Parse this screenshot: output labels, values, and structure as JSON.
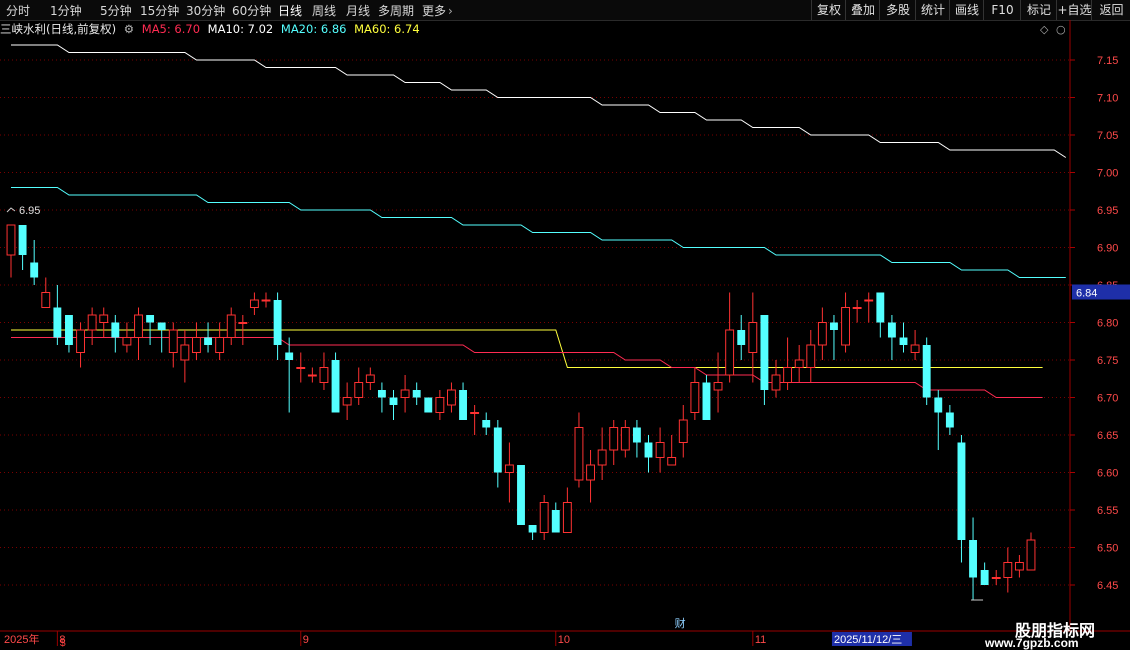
{
  "toolbar": {
    "periods": [
      "分时",
      "1分钟",
      "5分钟",
      "15分钟",
      "30分钟",
      "60分钟",
      "日线",
      "周线",
      "月线",
      "多周期",
      "更多"
    ],
    "active_period": "日线",
    "right_buttons": [
      "复权",
      "叠加",
      "多股",
      "统计",
      "画线",
      "F10",
      "标记",
      "+自选",
      "返回"
    ]
  },
  "info": {
    "stock_title": "三峡水利(日线,前复权)",
    "ma5_label": "MA5: 6.70",
    "ma10_label": "MA10: 7.02",
    "ma20_label": "MA20: 6.86",
    "ma60_label": "MA60: 6.74"
  },
  "colors": {
    "up": "#ff3232",
    "down": "#54ffff",
    "ma5": "#ff2b52",
    "ma10": "#ffffff",
    "ma20": "#54ffff",
    "ma60": "#ffff3c",
    "grid": "#7a0000",
    "axis_text": "#ff4a4a",
    "price_box": "#1e2fa8"
  },
  "chart_data": {
    "type": "candlestick",
    "yticks": [
      7.15,
      7.1,
      7.05,
      7.0,
      6.95,
      6.9,
      6.85,
      6.8,
      6.75,
      6.7,
      6.65,
      6.6,
      6.55,
      6.5,
      6.45
    ],
    "ylim": [
      6.42,
      7.18
    ],
    "current_price_label": "6.84",
    "high_marker": "6.95",
    "x_labels": [
      {
        "text": "2025年",
        "index": 0
      },
      {
        "text": "8",
        "index": 4
      },
      {
        "text": "9",
        "index": 25
      },
      {
        "text": "10",
        "index": 47
      },
      {
        "text": "11",
        "index": 64
      },
      {
        "text": "2025/11/12/三",
        "index": 71
      }
    ],
    "finance_marker": "财",
    "candles": [
      [
        6.89,
        6.93,
        6.93,
        6.86
      ],
      [
        6.93,
        6.89,
        6.93,
        6.87
      ],
      [
        6.88,
        6.86,
        6.91,
        6.85
      ],
      [
        6.82,
        6.84,
        6.86,
        6.83
      ],
      [
        6.82,
        6.78,
        6.85,
        6.77
      ],
      [
        6.81,
        6.77,
        6.81,
        6.76
      ],
      [
        6.76,
        6.79,
        6.8,
        6.74
      ],
      [
        6.79,
        6.81,
        6.82,
        6.77
      ],
      [
        6.8,
        6.81,
        6.82,
        6.78
      ],
      [
        6.8,
        6.78,
        6.81,
        6.76
      ],
      [
        6.77,
        6.78,
        6.8,
        6.76
      ],
      [
        6.78,
        6.81,
        6.82,
        6.75
      ],
      [
        6.81,
        6.8,
        6.81,
        6.77
      ],
      [
        6.8,
        6.79,
        6.8,
        6.76
      ],
      [
        6.76,
        6.79,
        6.8,
        6.74
      ],
      [
        6.75,
        6.77,
        6.79,
        6.72
      ],
      [
        6.76,
        6.78,
        6.8,
        6.75
      ],
      [
        6.78,
        6.77,
        6.8,
        6.76
      ],
      [
        6.76,
        6.78,
        6.8,
        6.75
      ],
      [
        6.78,
        6.81,
        6.82,
        6.77
      ],
      [
        6.8,
        6.8,
        6.81,
        6.77
      ],
      [
        6.82,
        6.83,
        6.84,
        6.81
      ],
      [
        6.83,
        6.83,
        6.84,
        6.82
      ],
      [
        6.83,
        6.77,
        6.84,
        6.75
      ],
      [
        6.76,
        6.75,
        6.78,
        6.68
      ],
      [
        6.74,
        6.74,
        6.76,
        6.72
      ],
      [
        6.73,
        6.73,
        6.74,
        6.72
      ],
      [
        6.72,
        6.74,
        6.76,
        6.71
      ],
      [
        6.75,
        6.68,
        6.76,
        6.68
      ],
      [
        6.69,
        6.7,
        6.72,
        6.67
      ],
      [
        6.7,
        6.72,
        6.74,
        6.69
      ],
      [
        6.72,
        6.73,
        6.74,
        6.71
      ],
      [
        6.71,
        6.7,
        6.72,
        6.68
      ],
      [
        6.7,
        6.69,
        6.71,
        6.67
      ],
      [
        6.7,
        6.71,
        6.73,
        6.68
      ],
      [
        6.71,
        6.7,
        6.72,
        6.69
      ],
      [
        6.7,
        6.68,
        6.7,
        6.68
      ],
      [
        6.68,
        6.7,
        6.71,
        6.67
      ],
      [
        6.69,
        6.71,
        6.72,
        6.68
      ],
      [
        6.71,
        6.67,
        6.72,
        6.67
      ],
      [
        6.68,
        6.68,
        6.69,
        6.65
      ],
      [
        6.67,
        6.66,
        6.68,
        6.65
      ],
      [
        6.66,
        6.6,
        6.67,
        6.58
      ],
      [
        6.6,
        6.61,
        6.64,
        6.56
      ],
      [
        6.61,
        6.53,
        6.61,
        6.53
      ],
      [
        6.53,
        6.52,
        6.53,
        6.51
      ],
      [
        6.52,
        6.56,
        6.57,
        6.51
      ],
      [
        6.55,
        6.52,
        6.56,
        6.52
      ],
      [
        6.52,
        6.56,
        6.58,
        6.52
      ],
      [
        6.59,
        6.66,
        6.68,
        6.58
      ],
      [
        6.59,
        6.61,
        6.63,
        6.56
      ],
      [
        6.61,
        6.63,
        6.66,
        6.59
      ],
      [
        6.63,
        6.66,
        6.67,
        6.61
      ],
      [
        6.63,
        6.66,
        6.67,
        6.62
      ],
      [
        6.66,
        6.64,
        6.67,
        6.62
      ],
      [
        6.64,
        6.62,
        6.65,
        6.6
      ],
      [
        6.62,
        6.64,
        6.66,
        6.6
      ],
      [
        6.61,
        6.62,
        6.65,
        6.61
      ],
      [
        6.64,
        6.67,
        6.69,
        6.62
      ],
      [
        6.68,
        6.72,
        6.74,
        6.67
      ],
      [
        6.72,
        6.67,
        6.73,
        6.67
      ],
      [
        6.71,
        6.72,
        6.76,
        6.68
      ],
      [
        6.73,
        6.79,
        6.84,
        6.72
      ],
      [
        6.79,
        6.77,
        6.81,
        6.75
      ],
      [
        6.76,
        6.8,
        6.84,
        6.72
      ],
      [
        6.81,
        6.71,
        6.81,
        6.69
      ],
      [
        6.71,
        6.73,
        6.75,
        6.7
      ],
      [
        6.72,
        6.74,
        6.78,
        6.71
      ],
      [
        6.74,
        6.75,
        6.77,
        6.72
      ],
      [
        6.74,
        6.77,
        6.79,
        6.72
      ],
      [
        6.77,
        6.8,
        6.82,
        6.75
      ],
      [
        6.8,
        6.79,
        6.81,
        6.75
      ],
      [
        6.77,
        6.82,
        6.84,
        6.76
      ],
      [
        6.82,
        6.82,
        6.83,
        6.8
      ],
      [
        6.83,
        6.83,
        6.84,
        6.8
      ],
      [
        6.84,
        6.8,
        6.84,
        6.78
      ],
      [
        6.8,
        6.78,
        6.81,
        6.75
      ],
      [
        6.78,
        6.77,
        6.8,
        6.76
      ],
      [
        6.76,
        6.77,
        6.79,
        6.75
      ],
      [
        6.77,
        6.7,
        6.78,
        6.69
      ],
      [
        6.7,
        6.68,
        6.71,
        6.63
      ],
      [
        6.68,
        6.66,
        6.69,
        6.65
      ],
      [
        6.64,
        6.51,
        6.65,
        6.48
      ],
      [
        6.51,
        6.46,
        6.54,
        6.43
      ],
      [
        6.47,
        6.45,
        6.48,
        6.45
      ],
      [
        6.46,
        6.46,
        6.47,
        6.45
      ],
      [
        6.46,
        6.48,
        6.5,
        6.44
      ],
      [
        6.47,
        6.48,
        6.49,
        6.46
      ],
      [
        6.47,
        6.51,
        6.52,
        6.47
      ]
    ],
    "series": [
      {
        "name": "MA10",
        "values": [
          7.17,
          7.17,
          7.17,
          7.17,
          7.17,
          7.16,
          7.16,
          7.16,
          7.16,
          7.16,
          7.16,
          7.16,
          7.16,
          7.16,
          7.16,
          7.16,
          7.15,
          7.15,
          7.15,
          7.15,
          7.15,
          7.15,
          7.14,
          7.14,
          7.14,
          7.14,
          7.14,
          7.14,
          7.14,
          7.13,
          7.13,
          7.13,
          7.13,
          7.13,
          7.12,
          7.12,
          7.12,
          7.12,
          7.11,
          7.11,
          7.11,
          7.11,
          7.1,
          7.1,
          7.1,
          7.1,
          7.1,
          7.1,
          7.1,
          7.1,
          7.1,
          7.09,
          7.09,
          7.09,
          7.09,
          7.09,
          7.08,
          7.08,
          7.08,
          7.08,
          7.07,
          7.07,
          7.07,
          7.07,
          7.06,
          7.06,
          7.06,
          7.06,
          7.06,
          7.05,
          7.05,
          7.05,
          7.05,
          7.05,
          7.05,
          7.04,
          7.04,
          7.04,
          7.04,
          7.04,
          7.04,
          7.03,
          7.03,
          7.03,
          7.03,
          7.03,
          7.03,
          7.03,
          7.03,
          7.03,
          7.03,
          7.02
        ]
      },
      {
        "name": "MA20",
        "values": [
          6.98,
          6.98,
          6.98,
          6.98,
          6.98,
          6.97,
          6.97,
          6.97,
          6.97,
          6.97,
          6.97,
          6.97,
          6.97,
          6.97,
          6.97,
          6.97,
          6.97,
          6.96,
          6.96,
          6.96,
          6.96,
          6.96,
          6.96,
          6.96,
          6.96,
          6.95,
          6.95,
          6.95,
          6.95,
          6.95,
          6.95,
          6.95,
          6.94,
          6.94,
          6.94,
          6.94,
          6.94,
          6.94,
          6.94,
          6.93,
          6.93,
          6.93,
          6.93,
          6.93,
          6.93,
          6.92,
          6.92,
          6.92,
          6.92,
          6.92,
          6.92,
          6.91,
          6.91,
          6.91,
          6.91,
          6.91,
          6.91,
          6.91,
          6.9,
          6.9,
          6.9,
          6.9,
          6.9,
          6.9,
          6.9,
          6.9,
          6.89,
          6.89,
          6.89,
          6.89,
          6.89,
          6.89,
          6.89,
          6.89,
          6.89,
          6.89,
          6.88,
          6.88,
          6.88,
          6.88,
          6.88,
          6.88,
          6.87,
          6.87,
          6.87,
          6.87,
          6.87,
          6.86,
          6.86,
          6.86,
          6.86,
          6.86
        ]
      },
      {
        "name": "MA60",
        "values": [
          6.79,
          6.79,
          6.79,
          6.79,
          6.79,
          6.79,
          6.79,
          6.79,
          6.79,
          6.79,
          6.79,
          6.79,
          6.79,
          6.79,
          6.79,
          6.79,
          6.79,
          6.79,
          6.79,
          6.79,
          6.79,
          6.79,
          6.79,
          6.79,
          6.79,
          6.79,
          6.79,
          6.79,
          6.79,
          6.79,
          6.79,
          6.79,
          6.79,
          6.79,
          6.79,
          6.79,
          6.79,
          6.79,
          6.79,
          6.79,
          6.79,
          6.79,
          6.79,
          6.79,
          6.79,
          6.79,
          6.79,
          6.79,
          6.74,
          6.74,
          6.74,
          6.74,
          6.74,
          6.74,
          6.74,
          6.74,
          6.74,
          6.74,
          6.74,
          6.74,
          6.74,
          6.74,
          6.74,
          6.74,
          6.74,
          6.74,
          6.74,
          6.74,
          6.74,
          6.74,
          6.74,
          6.74,
          6.74,
          6.74,
          6.74,
          6.74,
          6.74,
          6.74,
          6.74,
          6.74,
          6.74,
          6.74,
          6.74,
          6.74,
          6.74,
          6.74,
          6.74,
          6.74,
          6.74,
          6.74
        ]
      },
      {
        "name": "MA5",
        "values": [
          6.78,
          6.78,
          6.78,
          6.78,
          6.78,
          6.78,
          6.78,
          6.78,
          6.78,
          6.78,
          6.78,
          6.78,
          6.78,
          6.78,
          6.78,
          6.78,
          6.78,
          6.78,
          6.78,
          6.78,
          6.78,
          6.78,
          6.78,
          6.78,
          6.77,
          6.77,
          6.77,
          6.77,
          6.77,
          6.77,
          6.77,
          6.77,
          6.77,
          6.77,
          6.77,
          6.77,
          6.77,
          6.77,
          6.77,
          6.77,
          6.76,
          6.76,
          6.76,
          6.76,
          6.76,
          6.76,
          6.76,
          6.76,
          6.76,
          6.76,
          6.76,
          6.76,
          6.76,
          6.75,
          6.75,
          6.75,
          6.75,
          6.74,
          6.74,
          6.74,
          6.73,
          6.73,
          6.73,
          6.73,
          6.73,
          6.72,
          6.72,
          6.72,
          6.72,
          6.72,
          6.72,
          6.72,
          6.72,
          6.72,
          6.72,
          6.72,
          6.72,
          6.72,
          6.72,
          6.71,
          6.71,
          6.71,
          6.71,
          6.71,
          6.71,
          6.7,
          6.7,
          6.7,
          6.7,
          6.7
        ]
      }
    ]
  },
  "watermark": {
    "title": "股朋指标网",
    "url": "www.7gpzb.com"
  }
}
